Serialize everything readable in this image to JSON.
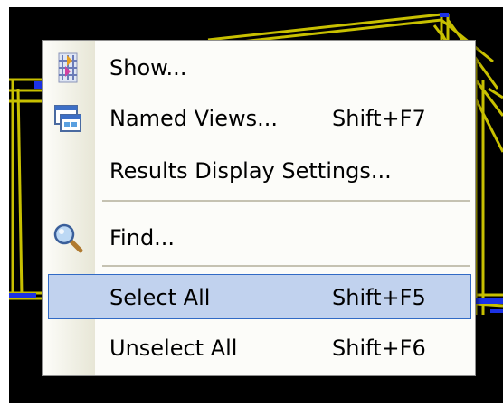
{
  "menu": {
    "items": [
      {
        "label": "Show...",
        "shortcut": "",
        "icon": "show-icon"
      },
      {
        "label": "Named Views...",
        "shortcut": "Shift+F7",
        "icon": "named-views-icon"
      },
      {
        "label": "Results Display Settings...",
        "shortcut": "",
        "icon": ""
      },
      {
        "label": "Find...",
        "shortcut": "",
        "icon": "magnifier-icon"
      },
      {
        "label": "Select All",
        "shortcut": "Shift+F5",
        "icon": "",
        "highlighted": true
      },
      {
        "label": "Unselect All",
        "shortcut": "Shift+F6",
        "icon": ""
      }
    ]
  },
  "colors": {
    "highlight_fill": "#c1d2ee",
    "highlight_border": "#316ac5",
    "model_lines": "#c8c000",
    "model_nodes": "#1c32e6",
    "background": "#000000"
  }
}
